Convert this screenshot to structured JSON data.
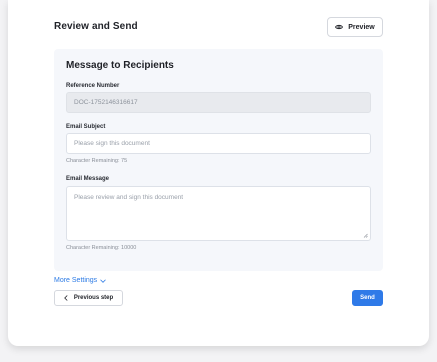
{
  "header": {
    "title": "Review and Send",
    "preview_label": "Preview",
    "preview_icon": "eye-icon"
  },
  "panel": {
    "title": "Message to Recipients",
    "reference": {
      "label": "Reference Number",
      "value": "DOC-1752146316617"
    },
    "subject": {
      "label": "Email Subject",
      "placeholder": "Please sign this document",
      "helper": "Character Remaining: 75"
    },
    "message": {
      "label": "Email Message",
      "placeholder": "Please review and sign this document",
      "helper": "Character Remaining: 10000"
    }
  },
  "footer": {
    "more_settings_label": "More Settings",
    "more_settings_icon": "chevron-down-icon",
    "previous_label": "Previous step",
    "previous_icon": "chevron-left-icon",
    "send_label": "Send"
  },
  "colors": {
    "accent": "#2f7ae8",
    "panel_bg": "#f5f7fb"
  }
}
